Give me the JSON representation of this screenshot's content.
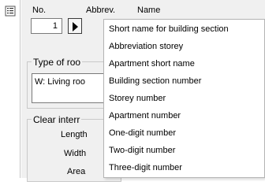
{
  "header": {
    "no_label": "No.",
    "abbrev_label": "Abbrev.",
    "name_label": "Name"
  },
  "number_field": {
    "value": "1"
  },
  "type_of_room": {
    "title": "Type of roo",
    "value": "W: Living roo"
  },
  "clear_internal": {
    "title": "Clear interr",
    "length_label": "Length",
    "width_label": "Width",
    "area_label": "Area"
  },
  "dropdown": {
    "items": [
      "Short name for building section",
      "Abbreviation storey",
      "Apartment short name",
      "Building section number",
      "Storey number",
      "Apartment number",
      "One-digit number",
      "Two-digit number",
      "Three-digit number"
    ]
  },
  "icons": {
    "strip_icon": "list-properties-icon",
    "arrow_icon": "triangle-right-icon"
  }
}
